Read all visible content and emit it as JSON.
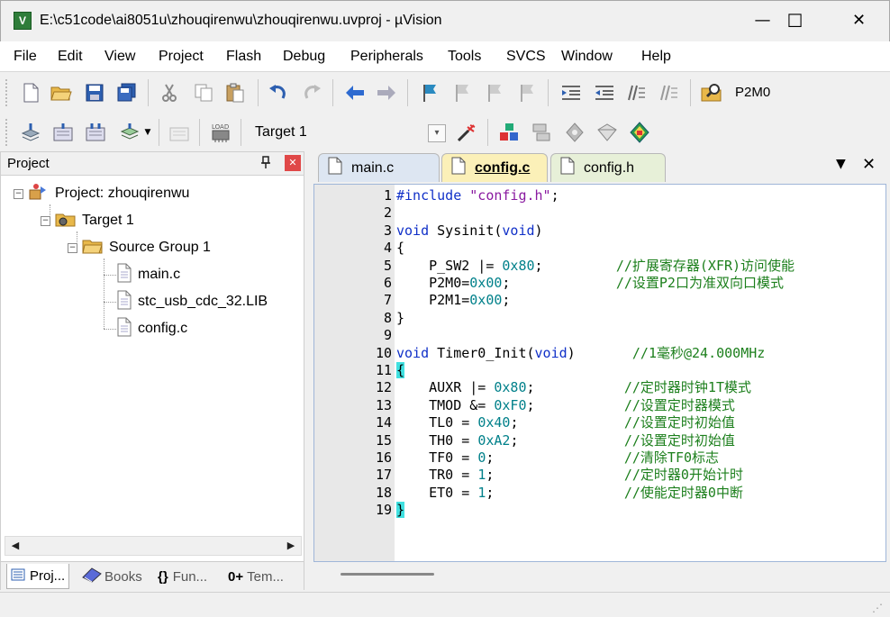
{
  "window": {
    "title": "E:\\c51code\\ai8051u\\zhouqirenwu\\zhouqirenwu.uvproj - µVision",
    "app_icon": "V",
    "minimize": "—",
    "maximize": "☐",
    "close": "✕"
  },
  "menu": [
    "File",
    "Edit",
    "View",
    "Project",
    "Flash",
    "Debug",
    "Peripherals",
    "Tools",
    "SVCS",
    "Window",
    "Help"
  ],
  "toolbar1": {
    "icons": [
      "new-file-icon",
      "open-folder-icon",
      "save-icon",
      "save-all-icon",
      "cut-icon",
      "copy-icon",
      "paste-icon",
      "undo-icon",
      "redo-icon",
      "navigate-back-icon",
      "navigate-forward-icon",
      "bookmark-insert-icon",
      "bookmark-prev-icon",
      "bookmark-next-icon",
      "bookmark-clear-icon",
      "indent-icon",
      "unindent-icon",
      "comment-icon",
      "uncomment-icon",
      "find-in-files-icon"
    ],
    "find_text": "P2M0"
  },
  "toolbar2": {
    "icons": [
      "translate-icon",
      "build-icon",
      "rebuild-icon",
      "batch-build-icon",
      "stop-build-icon",
      "download-icon",
      "target-options-icon",
      "manage-components-icon",
      "file-extensions-icon",
      "select-packs-icon",
      "pack-installer-icon",
      "manage-run-time-icon"
    ],
    "target": "Target 1",
    "dropdown_arrow": "▾"
  },
  "project_panel": {
    "title": "Project",
    "pin": "📌",
    "close": "✕",
    "tree": {
      "root": "Project: zhouqirenwu",
      "target": "Target 1",
      "group": "Source Group 1",
      "files": [
        "main.c",
        "stc_usb_cdc_32.LIB",
        "config.c"
      ],
      "toggles": [
        "−",
        "−",
        "−"
      ]
    },
    "scroll_left": "◀",
    "scroll_right": "▶",
    "tabs": [
      "Proj...",
      "Books",
      "Fun...",
      "Tem..."
    ],
    "tab_icons": [
      "{}",
      "0+"
    ]
  },
  "editor": {
    "tabs": [
      "main.c",
      "config.c",
      "config.h"
    ],
    "active_tab": "config.c",
    "tab_menu": "▼",
    "tab_close": "✕",
    "line_numbers": [
      "1",
      "2",
      "3",
      "4",
      "5",
      "6",
      "7",
      "8",
      "9",
      "10",
      "11",
      "12",
      "13",
      "14",
      "15",
      "16",
      "17",
      "18",
      "19"
    ],
    "lines": [
      [
        {
          "t": "#include ",
          "c": "kw"
        },
        {
          "t": "\"config.h\"",
          "c": "str"
        },
        {
          "t": ";",
          "c": ""
        }
      ],
      [],
      [
        {
          "t": "void",
          "c": "kw"
        },
        {
          "t": " Sysinit(",
          "c": ""
        },
        {
          "t": "void",
          "c": "kw"
        },
        {
          "t": ")",
          "c": ""
        }
      ],
      [
        {
          "t": "{",
          "c": ""
        }
      ],
      [
        {
          "t": "    P_SW2 |= ",
          "c": ""
        },
        {
          "t": "0x80",
          "c": "num"
        },
        {
          "t": ";         ",
          "c": ""
        },
        {
          "t": "//扩展寄存器(XFR)访问使能",
          "c": "cmt"
        }
      ],
      [
        {
          "t": "    P2M0=",
          "c": ""
        },
        {
          "t": "0x00",
          "c": "num"
        },
        {
          "t": ";             ",
          "c": ""
        },
        {
          "t": "//设置P2口为准双向口模式",
          "c": "cmt"
        }
      ],
      [
        {
          "t": "    P2M1=",
          "c": ""
        },
        {
          "t": "0x00",
          "c": "num"
        },
        {
          "t": ";",
          "c": ""
        }
      ],
      [
        {
          "t": "}",
          "c": ""
        }
      ],
      [],
      [
        {
          "t": "void",
          "c": "kw"
        },
        {
          "t": " Timer0_Init(",
          "c": ""
        },
        {
          "t": "void",
          "c": "kw"
        },
        {
          "t": ")       ",
          "c": ""
        },
        {
          "t": "//1毫秒@24.000MHz",
          "c": "cmt"
        }
      ],
      [
        {
          "t": "{",
          "c": "brace"
        }
      ],
      [
        {
          "t": "    AUXR |= ",
          "c": ""
        },
        {
          "t": "0x80",
          "c": "num"
        },
        {
          "t": ";           ",
          "c": ""
        },
        {
          "t": "//定时器时钟1T模式",
          "c": "cmt"
        }
      ],
      [
        {
          "t": "    TMOD &= ",
          "c": ""
        },
        {
          "t": "0xF0",
          "c": "num"
        },
        {
          "t": ";           ",
          "c": ""
        },
        {
          "t": "//设置定时器模式",
          "c": "cmt"
        }
      ],
      [
        {
          "t": "    TL0 = ",
          "c": ""
        },
        {
          "t": "0x40",
          "c": "num"
        },
        {
          "t": ";             ",
          "c": ""
        },
        {
          "t": "//设置定时初始值",
          "c": "cmt"
        }
      ],
      [
        {
          "t": "    TH0 = ",
          "c": ""
        },
        {
          "t": "0xA2",
          "c": "num"
        },
        {
          "t": ";             ",
          "c": ""
        },
        {
          "t": "//设置定时初始值",
          "c": "cmt"
        }
      ],
      [
        {
          "t": "    TF0 = ",
          "c": ""
        },
        {
          "t": "0",
          "c": "num"
        },
        {
          "t": ";                ",
          "c": ""
        },
        {
          "t": "//清除TF0标志",
          "c": "cmt"
        }
      ],
      [
        {
          "t": "    TR0 = ",
          "c": ""
        },
        {
          "t": "1",
          "c": "num"
        },
        {
          "t": ";                ",
          "c": ""
        },
        {
          "t": "//定时器0开始计时",
          "c": "cmt"
        }
      ],
      [
        {
          "t": "    ET0 = ",
          "c": ""
        },
        {
          "t": "1",
          "c": "num"
        },
        {
          "t": ";                ",
          "c": ""
        },
        {
          "t": "//使能定时器0中断",
          "c": "cmt"
        }
      ],
      [
        {
          "t": "}",
          "c": "brace"
        }
      ]
    ]
  },
  "status": {
    "grip": "⋰"
  }
}
